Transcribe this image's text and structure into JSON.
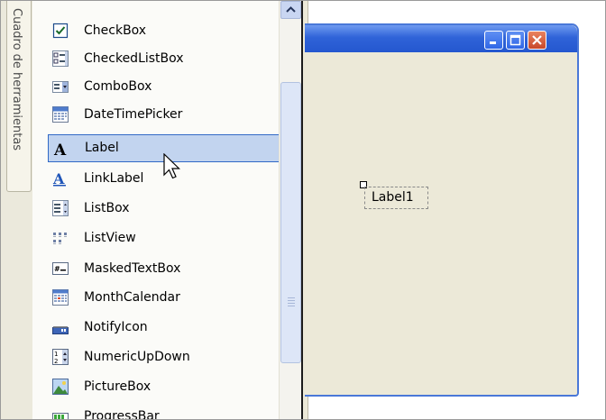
{
  "vertical_tab": {
    "label": "Cuadro de herramientas"
  },
  "toolbox": {
    "items": [
      {
        "label": "CheckBox",
        "icon": "checkbox-icon"
      },
      {
        "label": "CheckedListBox",
        "icon": "checked-listbox-icon"
      },
      {
        "label": "ComboBox",
        "icon": "combobox-icon"
      },
      {
        "label": "DateTimePicker",
        "icon": "datetimepicker-icon"
      },
      {
        "label": "Label",
        "icon": "label-icon",
        "selected": true
      },
      {
        "label": "LinkLabel",
        "icon": "linklabel-icon"
      },
      {
        "label": "ListBox",
        "icon": "listbox-icon"
      },
      {
        "label": "ListView",
        "icon": "listview-icon"
      },
      {
        "label": "MaskedTextBox",
        "icon": "maskedtextbox-icon"
      },
      {
        "label": "MonthCalendar",
        "icon": "monthcalendar-icon"
      },
      {
        "label": "NotifyIcon",
        "icon": "notifyicon-icon"
      },
      {
        "label": "NumericUpDown",
        "icon": "numericupdown-icon"
      },
      {
        "label": "PictureBox",
        "icon": "picturebox-icon"
      },
      {
        "label": "ProgressBar",
        "icon": "progressbar-icon"
      }
    ]
  },
  "form": {
    "label_control": {
      "text": "Label1"
    }
  },
  "colors": {
    "selection_bg": "#c2d4ef",
    "selection_border": "#3169c6",
    "titlebar": "#2f63d8",
    "close_button": "#c8482a",
    "form_bg": "#ece9d8"
  }
}
